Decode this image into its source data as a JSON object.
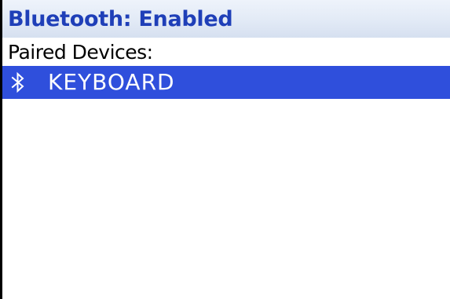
{
  "header": {
    "title": "Bluetooth: Enabled"
  },
  "paired_section": {
    "label": "Paired Devices:"
  },
  "devices": [
    {
      "icon": "bluetooth-icon",
      "name": "KEYBOARD",
      "selected": true
    }
  ],
  "colors": {
    "title_text": "#1f3fb8",
    "title_bar": "#e2eaf6",
    "selection": "#2f4fdc",
    "selected_text": "#ffffff",
    "background": "#ffffff"
  }
}
